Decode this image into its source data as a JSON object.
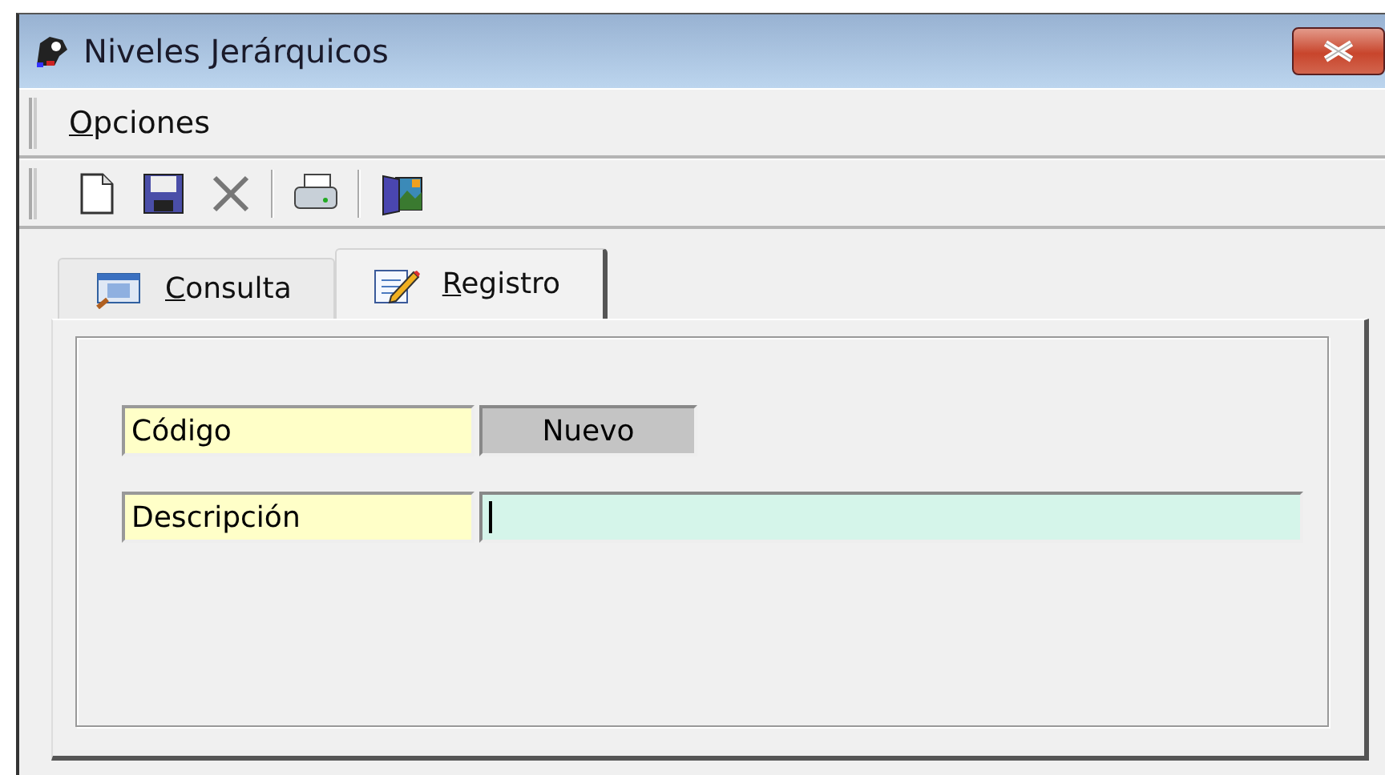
{
  "window": {
    "title": "Niveles Jerárquicos"
  },
  "menu": [
    "Opciones"
  ],
  "tabs": [
    {
      "label": "Consulta",
      "selected": false
    },
    {
      "label": "Registro",
      "selected": true
    }
  ],
  "fields": [
    {
      "kind": "readonly",
      "label": "Código",
      "value": "Nuevo"
    },
    {
      "kind": "input",
      "label": "Descripción",
      "focused": true
    }
  ]
}
